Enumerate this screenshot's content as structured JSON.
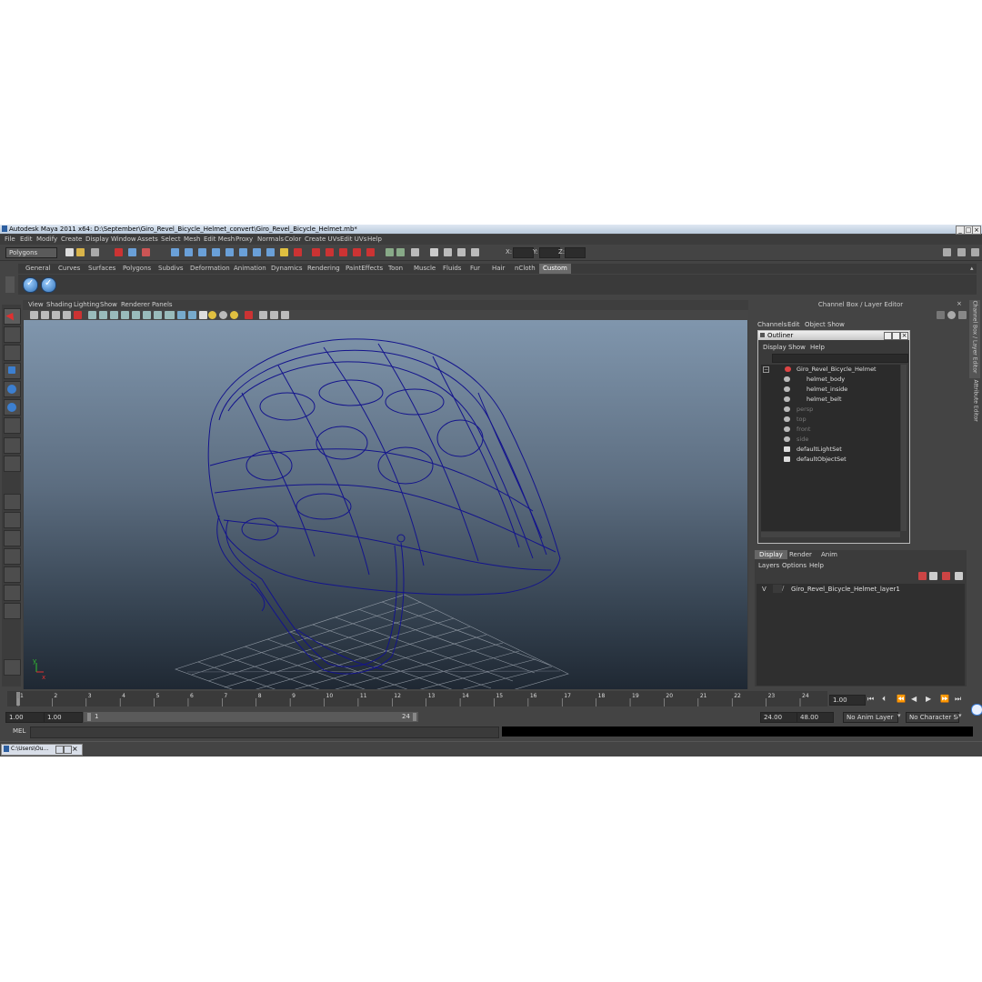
{
  "window": {
    "title": "Autodesk Maya 2011 x64: D:\\September\\Giro_Revel_Bicycle_Helmet_convert\\Giro_Revel_Bicycle_Helmet.mb*"
  },
  "menubar": [
    "File",
    "Edit",
    "Modify",
    "Create",
    "Display",
    "Window",
    "Assets",
    "Select",
    "Mesh",
    "Edit Mesh",
    "Proxy",
    "Normals",
    "Color",
    "Create UVs",
    "Edit UVs",
    "Help"
  ],
  "statusline": {
    "mode": "Polygons",
    "x_label": "X:",
    "y_label": "Y:",
    "z_label": "Z:"
  },
  "shelf": {
    "tabs": [
      "General",
      "Curves",
      "Surfaces",
      "Polygons",
      "Subdivs",
      "Deformation",
      "Animation",
      "Dynamics",
      "Rendering",
      "PaintEffects",
      "Toon",
      "Muscle",
      "Fluids",
      "Fur",
      "Hair",
      "nCloth",
      "Custom"
    ],
    "active_tab": "Custom"
  },
  "viewport": {
    "menu": [
      "View",
      "Shading",
      "Lighting",
      "Show",
      "Renderer",
      "Panels"
    ],
    "wire_color": "#14148c",
    "axis": {
      "x": "x",
      "y": "y"
    }
  },
  "channelbox": {
    "title": "Channel Box / Layer Editor",
    "menu": [
      "Channels",
      "Edit",
      "Object",
      "Show"
    ]
  },
  "outliner": {
    "title": "Outliner",
    "menu": [
      "Display",
      "Show",
      "Help"
    ],
    "items": [
      {
        "label": "Giro_Revel_Bicycle_Helmet",
        "dim": false
      },
      {
        "label": "helmet_body",
        "dim": false
      },
      {
        "label": "helmet_inside",
        "dim": false
      },
      {
        "label": "helmet_belt",
        "dim": false
      },
      {
        "label": "persp",
        "dim": true
      },
      {
        "label": "top",
        "dim": true
      },
      {
        "label": "front",
        "dim": true
      },
      {
        "label": "side",
        "dim": true
      },
      {
        "label": "defaultLightSet",
        "dim": false
      },
      {
        "label": "defaultObjectSet",
        "dim": false
      }
    ]
  },
  "layer_editor": {
    "tabs": [
      "Display",
      "Render",
      "Anim"
    ],
    "menu": [
      "Layers",
      "Options",
      "Help"
    ],
    "layer": {
      "visible": "V",
      "name": "Giro_Revel_Bicycle_Helmet_layer1"
    }
  },
  "side_tabs": [
    "Channel Box / Layer Editor",
    "Attribute Editor"
  ],
  "timeline": {
    "ticks": [
      "1",
      "2",
      "3",
      "4",
      "5",
      "6",
      "7",
      "8",
      "9",
      "10",
      "11",
      "12",
      "13",
      "14",
      "15",
      "16",
      "17",
      "18",
      "19",
      "20",
      "21",
      "22",
      "23",
      "24"
    ],
    "current_frame": "1.00"
  },
  "range": {
    "start": "1.00",
    "playback_start": "1.00",
    "range_start_label": "1",
    "range_end_label": "24",
    "playback_end": "24.00",
    "end": "48.00",
    "anim_layer": "No Anim Layer",
    "character_set": "No Character Set"
  },
  "mel": {
    "label": "MEL"
  },
  "taskbar": {
    "item": "C:\\Users\\Ou..."
  }
}
